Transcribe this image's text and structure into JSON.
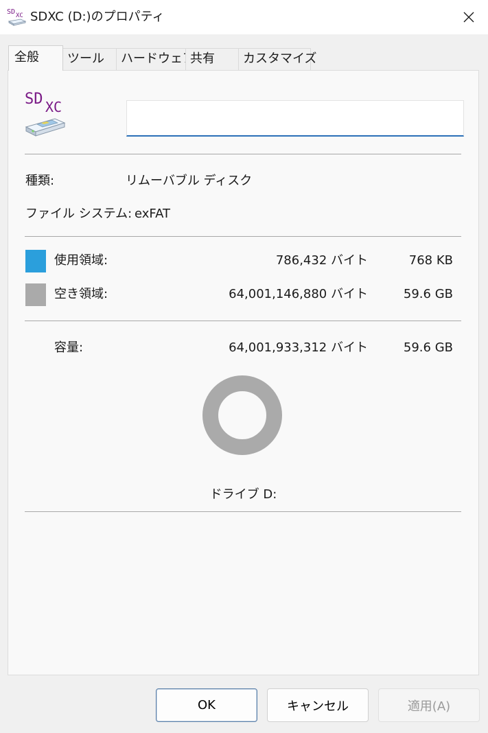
{
  "window": {
    "title": "SDXC (D:)のプロパティ",
    "close_glyph": "✕"
  },
  "tabs": [
    {
      "label": "全般",
      "active": true
    },
    {
      "label": "ツール",
      "active": false
    },
    {
      "label": "ハードウェア",
      "active": false
    },
    {
      "label": "共有",
      "active": false
    },
    {
      "label": "カスタマイズ",
      "active": false
    }
  ],
  "general": {
    "icon_text_top": "SD",
    "icon_text_sub": "XC",
    "volume_name_value": "",
    "type_label": "種類:",
    "type_value": "リムーバブル ディスク",
    "fs_label": "ファイル システム:",
    "fs_value": "exFAT",
    "used": {
      "label": "使用領域:",
      "bytes": "786,432 バイト",
      "size": "768 KB",
      "color": "#2b9fdc",
      "fraction": 1.23e-05
    },
    "free": {
      "label": "空き領域:",
      "bytes": "64,001,146,880 バイト",
      "size": "59.6 GB",
      "color": "#aaaaaa"
    },
    "capacity": {
      "label": "容量:",
      "bytes": "64,001,933,312 バイト",
      "size": "59.6 GB"
    },
    "drive_label": "ドライブ D:"
  },
  "buttons": {
    "ok": "OK",
    "cancel": "キャンセル",
    "apply": "適用(A)"
  },
  "icons": {
    "title": "sd-card-drive-icon",
    "close": "close-icon",
    "drive": "sdxc-drive-icon"
  }
}
